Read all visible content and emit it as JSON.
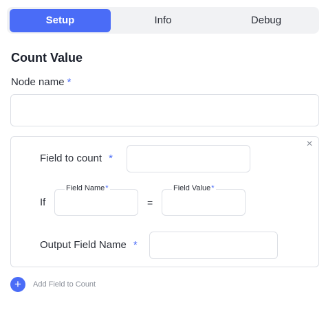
{
  "tabs": [
    {
      "label": "Setup",
      "active": true
    },
    {
      "label": "Info",
      "active": false
    },
    {
      "label": "Debug",
      "active": false
    }
  ],
  "section_title": "Count Value",
  "node_name": {
    "label": "Node name",
    "required_mark": "*",
    "value": ""
  },
  "count_card": {
    "close_glyph": "×",
    "field_to_count": {
      "label": "Field to count",
      "required_mark": "*",
      "value": ""
    },
    "condition": {
      "if_label": "If",
      "field_name": {
        "legend": "Field Name",
        "required_mark": "*",
        "value": ""
      },
      "operator": "=",
      "field_value": {
        "legend": "Field Value",
        "required_mark": "*",
        "value": ""
      }
    },
    "output_field_name": {
      "label": "Output Field Name",
      "required_mark": "*",
      "value": ""
    }
  },
  "add_field": {
    "icon_glyph": "+",
    "label": "Add Field to Count"
  },
  "colors": {
    "accent": "#4a6cf7",
    "border": "#dcdfe5",
    "tab_bg": "#f1f2f4"
  }
}
